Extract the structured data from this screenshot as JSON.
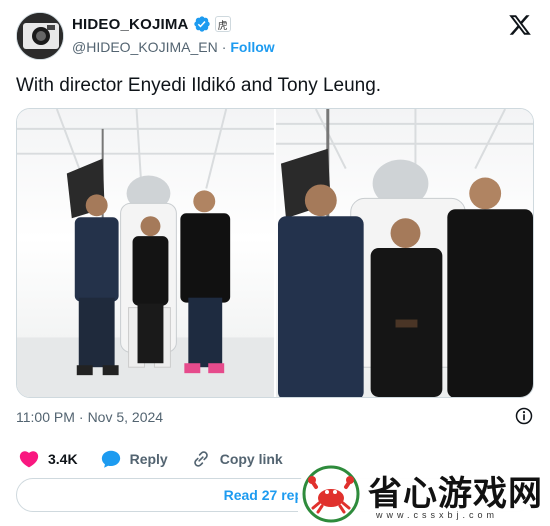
{
  "author": {
    "display_name": "HIDEO_KOJIMA",
    "handle": "@HIDEO_KOJIMA_EN",
    "separator": "·",
    "follow_label": "Follow",
    "affiliate_badge": "虎"
  },
  "tweet": {
    "text": "With director Enyedi Ildikó and Tony Leung.",
    "time": "11:00 PM",
    "separator": "·",
    "date": "Nov 5, 2024"
  },
  "actions": {
    "likes": "3.4K",
    "reply_label": "Reply",
    "copy_link_label": "Copy link"
  },
  "read_replies_label": "Read 27 replies",
  "watermark": {
    "text": "省心游戏网",
    "url": "www.cssxbj.com"
  },
  "colors": {
    "accent": "#1d9bf0",
    "like": "#f91880",
    "text": "#0f1419",
    "muted": "#536471",
    "border": "#cfd9de"
  },
  "icons": {
    "verified": "verified-badge-icon",
    "x_logo": "x-logo-icon",
    "info": "info-icon",
    "like": "heart-icon",
    "reply": "speech-bubble-icon",
    "copy_link": "link-icon"
  }
}
